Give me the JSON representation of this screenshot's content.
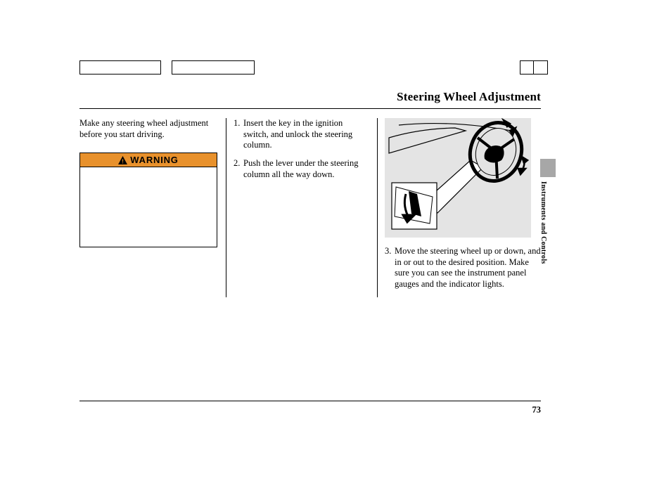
{
  "heading": "Steering Wheel Adjustment",
  "intro": "Make any steering wheel adjustment before you start driving.",
  "warning_label": "WARNING",
  "steps": {
    "s1": {
      "num": "1.",
      "text": "Insert the key in the ignition switch, and unlock the steering column."
    },
    "s2": {
      "num": "2.",
      "text": "Push the lever under the steering column all the way down."
    },
    "s3": {
      "num": "3.",
      "text": "Move the steering wheel up or down, and in or out to the desired position. Make sure you can see the instrument panel gauges and the indicator lights."
    }
  },
  "side_label": "Instruments and Controls",
  "page_number": "73"
}
